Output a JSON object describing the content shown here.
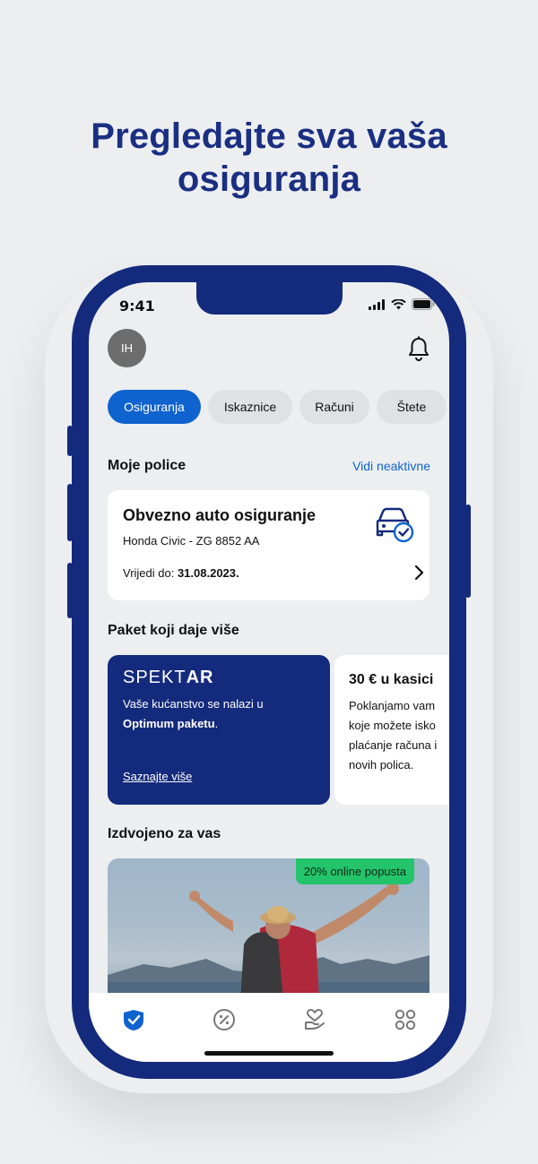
{
  "headline": {
    "line1": "Pregledajte sva vaša",
    "line2": "osiguranja"
  },
  "status": {
    "time": "9:41"
  },
  "user": {
    "initials": "IH"
  },
  "tabs": [
    {
      "label": "Osiguranja",
      "active": true
    },
    {
      "label": "Iskaznice",
      "active": false
    },
    {
      "label": "Računi",
      "active": false
    },
    {
      "label": "Štete",
      "active": false
    }
  ],
  "policies": {
    "title": "Moje police",
    "link": "Vidi neaktivne",
    "card": {
      "title": "Obvezno auto osiguranje",
      "subtitle": "Honda Civic - ZG 8852 AA",
      "valid_label": "Vrijedi do:",
      "valid_date": "31.08.2023."
    }
  },
  "package": {
    "title": "Paket koji daje više",
    "spektar": {
      "logo_light": "SPEKT",
      "logo_bold": "AR",
      "text_before": "Vaše kućanstvo se nalazi u",
      "text_bold": "Optimum paketu",
      "text_after": ".",
      "link": "Saznajte više"
    },
    "kasica": {
      "title": "30 € u kasici",
      "lines": [
        "Poklanjamo vam",
        "koje možete isko",
        "plaćanje računa i",
        "novih polica."
      ]
    }
  },
  "featured": {
    "title": "Izdvojeno za vas",
    "badge": "20% online popusta"
  },
  "colors": {
    "brand_navy": "#142a7c",
    "accent_blue": "#0f63cf",
    "promo_green": "#23c46b"
  },
  "nav": [
    "shield-check-icon",
    "discount-icon",
    "heart-hand-icon",
    "apps-grid-icon"
  ]
}
